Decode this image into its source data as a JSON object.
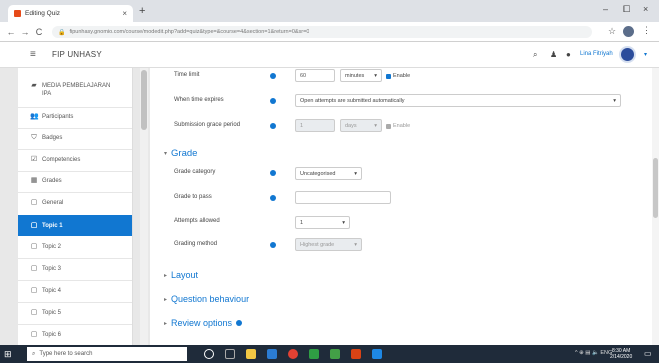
{
  "browser": {
    "tab_title": "Editing Quiz",
    "tab_close": "×",
    "new_tab": "+",
    "window_controls": [
      "–",
      "⧠",
      "×"
    ],
    "nav": [
      "←",
      "→",
      "C"
    ],
    "url": "fipunhasy.gnomio.com/course/modedit.php?add=quiz&type=&course=4&section=1&return=0&sr=0",
    "star": "☆",
    "menu": "⋮"
  },
  "navbar": {
    "hamburger": "≡",
    "site_name": "FIP UNHASY",
    "icons": [
      "⌕",
      "♟",
      "●"
    ],
    "user_name": "Lina Fitriyah",
    "user_caret": "▾"
  },
  "drawer": {
    "items": [
      {
        "icon": "▰",
        "label": "MEDIA PEMBELAJARAN IPA"
      },
      {
        "icon": "👥",
        "label": "Participants"
      },
      {
        "icon": "⛉",
        "label": "Badges"
      },
      {
        "icon": "☑",
        "label": "Competencies"
      },
      {
        "icon": "▦",
        "label": "Grades"
      },
      {
        "icon": "▢",
        "label": "General"
      },
      {
        "icon": "▢",
        "label": "Topic 1"
      },
      {
        "icon": "▢",
        "label": "Topic 2"
      },
      {
        "icon": "▢",
        "label": "Topic 3"
      },
      {
        "icon": "▢",
        "label": "Topic 4"
      },
      {
        "icon": "▢",
        "label": "Topic 5"
      },
      {
        "icon": "▢",
        "label": "Topic 6"
      }
    ],
    "active_index": 6
  },
  "timing": {
    "time_limit_label": "Time limit",
    "time_limit_value": "60",
    "time_limit_unit": "minutes",
    "time_limit_enable": "Enable",
    "when_expires_label": "When time expires",
    "when_expires_value": "Open attempts are submitted automatically",
    "grace_label": "Submission grace period",
    "grace_value": "1",
    "grace_unit": "days",
    "grace_enable": "Enable"
  },
  "grade": {
    "heading": "Grade",
    "category_label": "Grade category",
    "category_value": "Uncategorised",
    "to_pass_label": "Grade to pass",
    "to_pass_value": "",
    "attempts_label": "Attempts allowed",
    "attempts_value": "1",
    "method_label": "Grading method",
    "method_value": "Highest grade"
  },
  "sections": {
    "layout": "Layout",
    "question_behaviour": "Question behaviour",
    "review_options": "Review options"
  },
  "taskbar": {
    "start": "⊞",
    "search_icon": "⌕",
    "search_placeholder": "Type here to search",
    "tray": "^ ⊕ ▤ 🔈 ENG",
    "time": "8:30 AM",
    "date": "2/14/2020",
    "notif": "▭"
  },
  "colors": {
    "accent": "#1177d1",
    "taskbar": "#1f2b3a"
  }
}
